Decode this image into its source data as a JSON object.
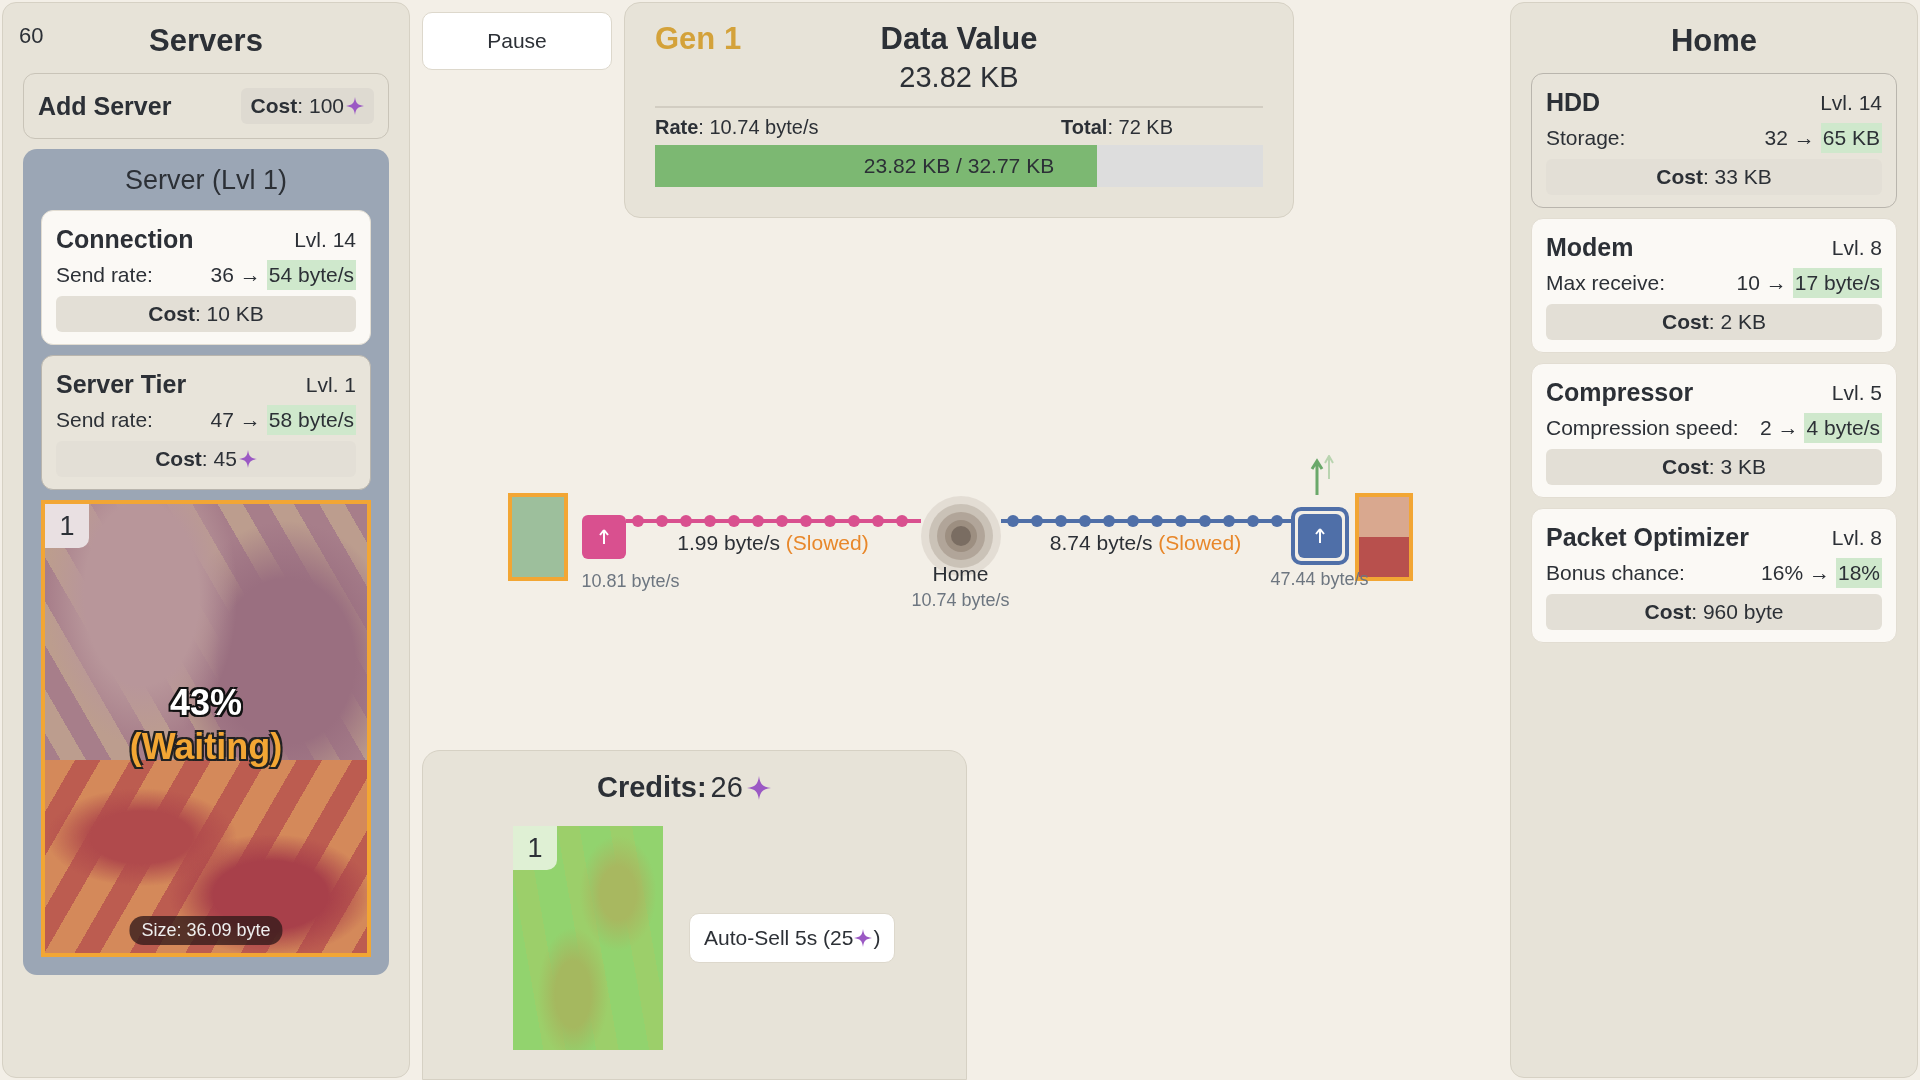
{
  "fps": "60",
  "servers": {
    "title": "Servers",
    "add_server": {
      "label": "Add Server",
      "cost": "**Cost**: 100",
      "credit_icon": true
    },
    "server": {
      "title": "Server (Lvl 1)",
      "upgrades": [
        {
          "name": "Connection",
          "lvl": "Lvl. 14",
          "stat": "Send rate:",
          "current": "36 →",
          "next": "54 byte/s",
          "cost": "**Cost**: 10 KB",
          "credit_icon": false,
          "affordable": true
        },
        {
          "name": "Server Tier",
          "lvl": "Lvl. 1",
          "stat": "Send rate:",
          "current": "47 →",
          "next": "58 byte/s",
          "cost": "**Cost**: 45",
          "credit_icon": true,
          "affordable": false
        }
      ],
      "packet": {
        "badge": "1",
        "percent": "43%",
        "status": "(Waiting)",
        "size": "Size: 36.09 byte",
        "level": 0.43
      }
    }
  },
  "pause": {
    "label": "Pause"
  },
  "data_value": {
    "gen": "Gen 1",
    "title": "Data Value",
    "value": "23.82 KB",
    "rate": "**Rate**: 10.74 byte/s",
    "total": "**Total**: 72 KB",
    "bar_text": "23.82 KB / 32.77 KB",
    "level": 0.727
  },
  "network": {
    "server_node": {
      "rate": "10.81 byte/s"
    },
    "uplink": {
      "rate": "1.99 byte/s",
      "note": "(Slowed)"
    },
    "home": {
      "label": "Home",
      "rate": "10.74 byte/s"
    },
    "downlink": {
      "rate": "8.74 byte/s",
      "note": "(Slowed)"
    },
    "client_node": {
      "rate": "47.44 byte/s"
    }
  },
  "credits": {
    "label": "Credits:",
    "value": "26",
    "packet": {
      "badge": "1"
    },
    "auto_sell": {
      "text": "Auto-Sell 5s (25",
      "suffix": ")"
    }
  },
  "home": {
    "title": "Home",
    "upgrades": [
      {
        "name": "HDD",
        "lvl": "Lvl. 14",
        "stat": "Storage:",
        "current": "32 →",
        "next": "65 KB",
        "cost": "**Cost**: 33 KB",
        "credit_icon": false,
        "affordable": false
      },
      {
        "name": "Modem",
        "lvl": "Lvl. 8",
        "stat": "Max receive:",
        "current": "10 →",
        "next": "17 byte/s",
        "cost": "**Cost**: 2 KB",
        "credit_icon": false,
        "affordable": true
      },
      {
        "name": "Compressor",
        "lvl": "Lvl. 5",
        "stat": "Compression speed:",
        "current": "2 →",
        "next": "4 byte/s",
        "cost": "**Cost**: 3 KB",
        "credit_icon": false,
        "affordable": true
      },
      {
        "name": "Packet Optimizer",
        "lvl": "Lvl. 8",
        "stat": "Bonus chance:",
        "current": "16% →",
        "next": "18%",
        "cost": "**Cost**: 960 byte",
        "credit_icon": false,
        "affordable": true
      }
    ]
  }
}
